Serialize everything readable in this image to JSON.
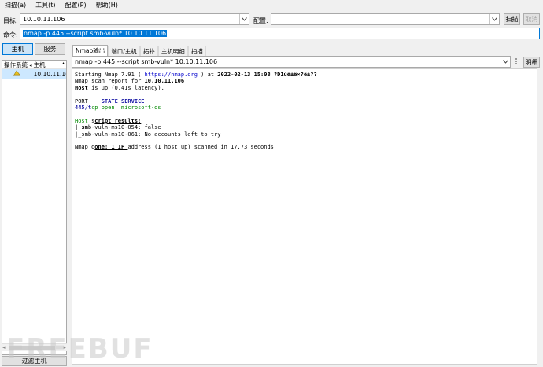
{
  "menu": [
    "扫描(a)",
    "工具(t)",
    "配置(P)",
    "帮助(H)"
  ],
  "target": {
    "label": "目标:",
    "value": "10.10.11.106"
  },
  "profile": {
    "label": "配置:",
    "value": ""
  },
  "scan_button": "扫描",
  "cancel_button": "取消",
  "command": {
    "label": "命令:",
    "value": "nmap -p 445 --script smb-vuln* 10.10.11.106"
  },
  "left": {
    "hosts_button": "主机",
    "services_button": "服务",
    "col_os": "操作系统",
    "col_host": "主机",
    "hosts": [
      {
        "name": "10.10.11.106"
      }
    ],
    "filter_button": "过滤主机"
  },
  "tabs": [
    "Nmap输出",
    "端口/主机",
    "拓扑",
    "主机明细",
    "扫描"
  ],
  "output_selector": {
    "value": "nmap -p 445 --script smb-vuln* 10.10.11.106",
    "details_button": "明细"
  },
  "output_lines": {
    "l1a": "Starting Nmap 7.91 ( ",
    "l1b": "https://nmap.org",
    "l1c": " ) at ",
    "l1d": "2022-02-13 15:08 ?D1úê±ê×?ê±??",
    "l2a": "Nmap scan report for ",
    "l2b": "10.10.11.106",
    "l3a": "Host",
    "l3b": " is up (0.41s latency).",
    "l5a": "PORT",
    "l5b": "    STATE SERVICE",
    "l6a": "445/t",
    "l6b": "cp open  microsoft-ds",
    "l8a": "Host",
    "l8b": " s",
    "l8c": "cript results:",
    "l9a": "| sm",
    "l9b": "b-vuln-ms10-054: false",
    "l10": "|_smb-vuln-ms10-061: No accounts left to try",
    "l12a": "Nmap d",
    "l12b": "one: 1 IP ",
    "l12c": "address (1 host up) scanned in 17.73 seconds"
  },
  "watermark": "FREEBUF"
}
